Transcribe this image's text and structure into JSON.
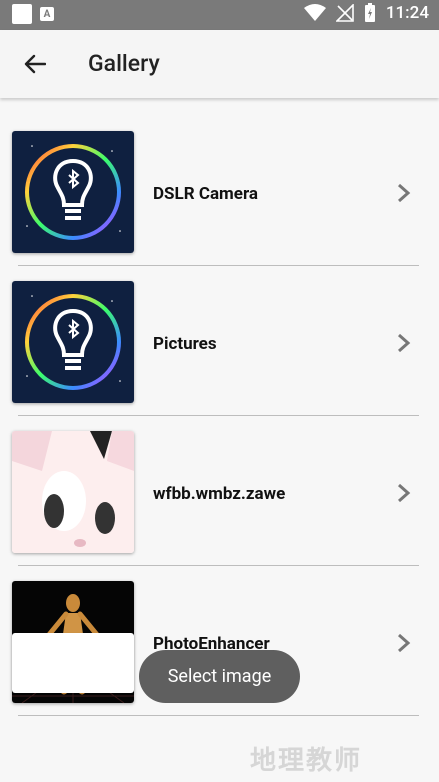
{
  "status_bar": {
    "time": "11:24"
  },
  "app_bar": {
    "title": "Gallery"
  },
  "items": [
    {
      "label": "DSLR Camera",
      "thumb": "bluetooth-bulb-icon"
    },
    {
      "label": "Pictures",
      "thumb": "bluetooth-bulb-icon"
    },
    {
      "label": "wfbb.wmbz.zawe",
      "thumb": "cartoon-face-image"
    },
    {
      "label": "PhotoEnhancer",
      "thumb": "figure-image"
    }
  ],
  "toast": {
    "text": "Select image"
  },
  "watermark": "地理教师",
  "colors": {
    "accent": "#0f2040",
    "toast_bg": "#5f5f5f"
  }
}
